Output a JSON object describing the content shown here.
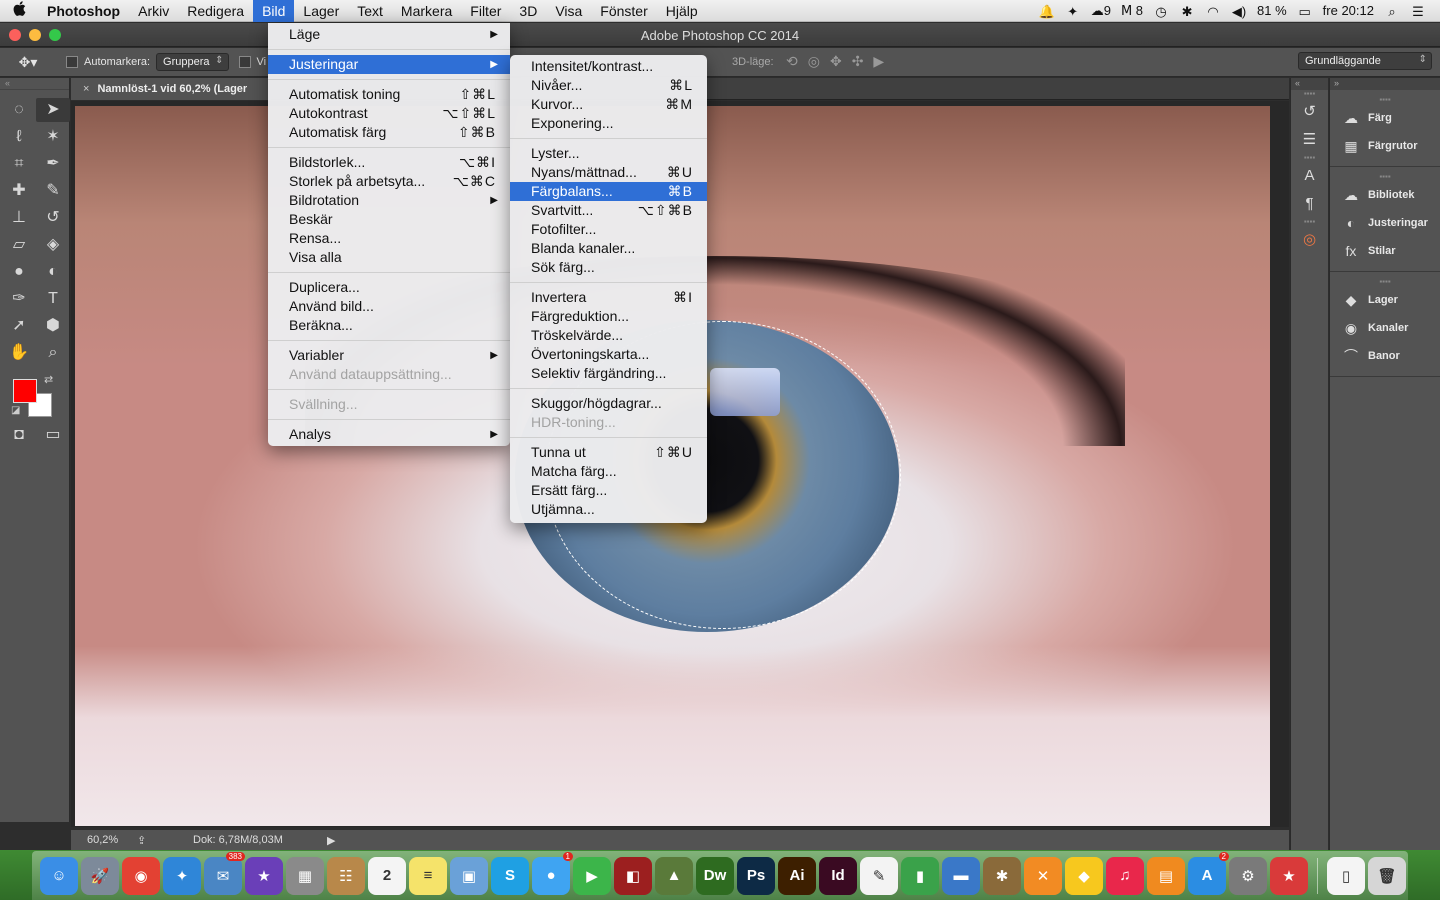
{
  "menubar": {
    "app_name": "Photoshop",
    "items": [
      "Arkiv",
      "Redigera",
      "Bild",
      "Lager",
      "Text",
      "Markera",
      "Filter",
      "3D",
      "Visa",
      "Fönster",
      "Hjälp"
    ],
    "active_item": "Bild",
    "status": {
      "cc_count": "9",
      "adobe_count": "8",
      "battery": "81 %",
      "clock": "fre 20:12"
    }
  },
  "window": {
    "title": "Adobe Photoshop CC 2014"
  },
  "options_bar": {
    "auto_select_label": "Automarkera:",
    "auto_select_value": "Gruppera",
    "show_transform_label": "Vi",
    "mode_3d_label": "3D-läge:",
    "workspace_value": "Grundläggande"
  },
  "document": {
    "tab_title": "Namnlöst-1 vid 60,2% (Lager",
    "zoom": "60,2%",
    "doc_size": "Dok: 6,78M/8,03M"
  },
  "bild_menu": {
    "items": [
      {
        "label": "Läge",
        "shortcut": "",
        "submenu": true
      },
      {
        "sep": true
      },
      {
        "label": "Justeringar",
        "shortcut": "",
        "submenu": true,
        "highlighted": true
      },
      {
        "sep": true
      },
      {
        "label": "Automatisk toning",
        "shortcut": "⇧⌘L"
      },
      {
        "label": "Autokontrast",
        "shortcut": "⌥⇧⌘L"
      },
      {
        "label": "Automatisk färg",
        "shortcut": "⇧⌘B"
      },
      {
        "sep": true
      },
      {
        "label": "Bildstorlek...",
        "shortcut": "⌥⌘I"
      },
      {
        "label": "Storlek på arbetsyta...",
        "shortcut": "⌥⌘C"
      },
      {
        "label": "Bildrotation",
        "shortcut": "",
        "submenu": true
      },
      {
        "label": "Beskär",
        "shortcut": ""
      },
      {
        "label": "Rensa...",
        "shortcut": ""
      },
      {
        "label": "Visa alla",
        "shortcut": ""
      },
      {
        "sep": true
      },
      {
        "label": "Duplicera...",
        "shortcut": ""
      },
      {
        "label": "Använd bild...",
        "shortcut": ""
      },
      {
        "label": "Beräkna...",
        "shortcut": ""
      },
      {
        "sep": true
      },
      {
        "label": "Variabler",
        "shortcut": "",
        "submenu": true
      },
      {
        "label": "Använd datauppsättning...",
        "shortcut": "",
        "disabled": true
      },
      {
        "sep": true
      },
      {
        "label": "Svällning...",
        "shortcut": "",
        "disabled": true
      },
      {
        "sep": true
      },
      {
        "label": "Analys",
        "shortcut": "",
        "submenu": true
      }
    ]
  },
  "justeringar_menu": {
    "items": [
      {
        "label": "Intensitet/kontrast...",
        "shortcut": ""
      },
      {
        "label": "Nivåer...",
        "shortcut": "⌘L"
      },
      {
        "label": "Kurvor...",
        "shortcut": "⌘M"
      },
      {
        "label": "Exponering...",
        "shortcut": ""
      },
      {
        "sep": true
      },
      {
        "label": "Lyster...",
        "shortcut": ""
      },
      {
        "label": "Nyans/mättnad...",
        "shortcut": "⌘U"
      },
      {
        "label": "Färgbalans...",
        "shortcut": "⌘B",
        "highlighted": true
      },
      {
        "label": "Svartvitt...",
        "shortcut": "⌥⇧⌘B"
      },
      {
        "label": "Fotofilter...",
        "shortcut": ""
      },
      {
        "label": "Blanda kanaler...",
        "shortcut": ""
      },
      {
        "label": "Sök färg...",
        "shortcut": ""
      },
      {
        "sep": true
      },
      {
        "label": "Invertera",
        "shortcut": "⌘I"
      },
      {
        "label": "Färgreduktion...",
        "shortcut": ""
      },
      {
        "label": "Tröskelvärde...",
        "shortcut": ""
      },
      {
        "label": "Övertoningskarta...",
        "shortcut": ""
      },
      {
        "label": "Selektiv färgändring...",
        "shortcut": ""
      },
      {
        "sep": true
      },
      {
        "label": "Skuggor/högdagrar...",
        "shortcut": ""
      },
      {
        "label": "HDR-toning...",
        "shortcut": "",
        "disabled": true
      },
      {
        "sep": true
      },
      {
        "label": "Tunna ut",
        "shortcut": "⇧⌘U"
      },
      {
        "label": "Matcha färg...",
        "shortcut": ""
      },
      {
        "label": "Ersätt färg...",
        "shortcut": ""
      },
      {
        "label": "Utjämna...",
        "shortcut": ""
      }
    ]
  },
  "panels": {
    "group1": [
      "Färg",
      "Färgrutor"
    ],
    "group2": [
      "Bibliotek",
      "Justeringar",
      "Stilar"
    ],
    "group3": [
      "Lager",
      "Kanaler",
      "Banor"
    ]
  },
  "colors": {
    "foreground": "#ff0000",
    "background": "#ffffff",
    "menu_highlight": "#2f6fd6"
  },
  "dock": {
    "apps": [
      {
        "name": "finder-icon",
        "color": "#3a8ee6",
        "glyph": "☺",
        "badge": ""
      },
      {
        "name": "launchpad-icon",
        "color": "#7d8a9a",
        "glyph": "🚀",
        "badge": ""
      },
      {
        "name": "chrome-icon",
        "color": "#e34133",
        "glyph": "◉",
        "badge": ""
      },
      {
        "name": "safari-icon",
        "color": "#2f86d8",
        "glyph": "✦",
        "badge": ""
      },
      {
        "name": "mail-icon",
        "color": "#4a86c4",
        "glyph": "✉",
        "badge": "383"
      },
      {
        "name": "imovie-icon",
        "color": "#6a3fb8",
        "glyph": "★",
        "badge": ""
      },
      {
        "name": "calculator-icon",
        "color": "#8a8a8a",
        "glyph": "▦",
        "badge": ""
      },
      {
        "name": "contacts-icon",
        "color": "#b8884a",
        "glyph": "☷",
        "badge": ""
      },
      {
        "name": "calendar-icon",
        "color": "#f4f4f4",
        "glyph": "2",
        "badge": ""
      },
      {
        "name": "notes-icon",
        "color": "#f5e36a",
        "glyph": "≡",
        "badge": ""
      },
      {
        "name": "preview-icon",
        "color": "#6aa1d8",
        "glyph": "▣",
        "badge": ""
      },
      {
        "name": "skype-icon",
        "color": "#1fa0e3",
        "glyph": "S",
        "badge": ""
      },
      {
        "name": "messages-icon",
        "color": "#3fa4f2",
        "glyph": "●",
        "badge": "1"
      },
      {
        "name": "facetime-icon",
        "color": "#3cb54a",
        "glyph": "▶",
        "badge": ""
      },
      {
        "name": "photo-booth-icon",
        "color": "#9c1f1f",
        "glyph": "◧",
        "badge": ""
      },
      {
        "name": "image-capture-icon",
        "color": "#5a7a3a",
        "glyph": "▲",
        "badge": ""
      },
      {
        "name": "dreamweaver-icon",
        "color": "#2e6b20",
        "glyph": "Dw",
        "badge": ""
      },
      {
        "name": "photoshop-icon",
        "color": "#0d2a45",
        "glyph": "Ps",
        "badge": ""
      },
      {
        "name": "illustrator-icon",
        "color": "#3d1f00",
        "glyph": "Ai",
        "badge": ""
      },
      {
        "name": "indesign-icon",
        "color": "#3a0a22",
        "glyph": "Id",
        "badge": ""
      },
      {
        "name": "textedit-icon",
        "color": "#f3f3f3",
        "glyph": "✎",
        "badge": ""
      },
      {
        "name": "numbers-icon",
        "color": "#3aa24a",
        "glyph": "▮",
        "badge": ""
      },
      {
        "name": "keynote-icon",
        "color": "#3a78c8",
        "glyph": "▬",
        "badge": ""
      },
      {
        "name": "squirrel-icon",
        "color": "#8a6a3a",
        "glyph": "✱",
        "badge": ""
      },
      {
        "name": "xcode-icon",
        "color": "#f28b23",
        "glyph": "✕",
        "badge": ""
      },
      {
        "name": "cyberduck-icon",
        "color": "#f7c81e",
        "glyph": "◆",
        "badge": ""
      },
      {
        "name": "itunes-icon",
        "color": "#e9274b",
        "glyph": "♫",
        "badge": ""
      },
      {
        "name": "ibooks-icon",
        "color": "#f08a1f",
        "glyph": "▤",
        "badge": ""
      },
      {
        "name": "app-store-icon",
        "color": "#2b8de3",
        "glyph": "A",
        "badge": "2"
      },
      {
        "name": "system-preferences-icon",
        "color": "#7a7a7a",
        "glyph": "⚙",
        "badge": ""
      },
      {
        "name": "bookmarks-icon",
        "color": "#d93a3a",
        "glyph": "★",
        "badge": ""
      },
      {
        "name": "document-icon",
        "color": "#f4f4f4",
        "glyph": "▯",
        "badge": ""
      },
      {
        "name": "trash-icon",
        "color": "#d6d6d6",
        "glyph": "🗑",
        "badge": ""
      }
    ]
  }
}
